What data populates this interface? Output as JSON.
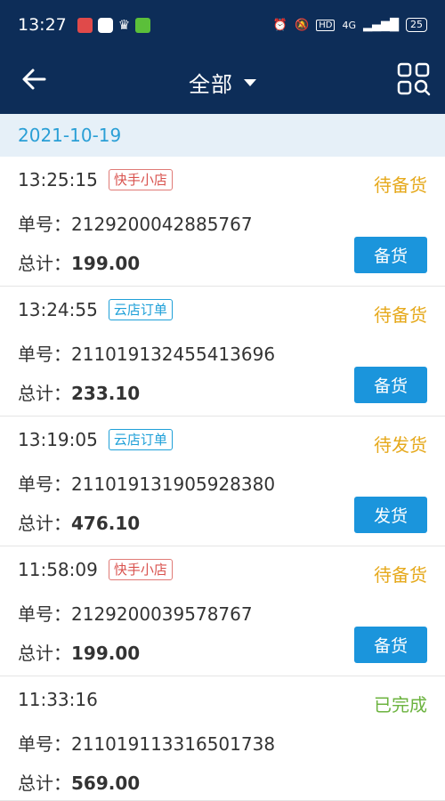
{
  "statusbar": {
    "time": "13:27",
    "network": "4G",
    "battery": "25"
  },
  "navbar": {
    "title": "全部"
  },
  "date_header": "2021-10-19",
  "orders": [
    {
      "time": "13:25:15",
      "tag": "快手小店",
      "tag_kind": "ks",
      "status": "待备货",
      "status_color": "#e6a91c",
      "order_no_label": "单号：",
      "order_no": "2129200042885767",
      "total_label": "总计：",
      "total": "199.00",
      "action": "备货"
    },
    {
      "time": "13:24:55",
      "tag": "云店订单",
      "tag_kind": "yd",
      "status": "待备货",
      "status_color": "#e6a91c",
      "order_no_label": "单号：",
      "order_no": "211019132455413696",
      "total_label": "总计：",
      "total": "233.10",
      "action": "备货"
    },
    {
      "time": "13:19:05",
      "tag": "云店订单",
      "tag_kind": "yd",
      "status": "待发货",
      "status_color": "#e6a91c",
      "order_no_label": "单号：",
      "order_no": "211019131905928380",
      "total_label": "总计：",
      "total": "476.10",
      "action": "发货"
    },
    {
      "time": "11:58:09",
      "tag": "快手小店",
      "tag_kind": "ks",
      "status": "待备货",
      "status_color": "#e6a91c",
      "order_no_label": "单号：",
      "order_no": "2129200039578767",
      "total_label": "总计：",
      "total": "199.00",
      "action": "备货"
    },
    {
      "time": "11:33:16",
      "tag": "",
      "tag_kind": "",
      "status": "已完成",
      "status_color": "#6cb33f",
      "order_no_label": "单号：",
      "order_no": "211019113316501738",
      "total_label": "总计：",
      "total": "569.00",
      "action": ""
    }
  ],
  "colors": {
    "header_bg": "#0d2d58",
    "accent": "#1b95dc",
    "pending": "#e6a91c",
    "done": "#6cb33f"
  }
}
